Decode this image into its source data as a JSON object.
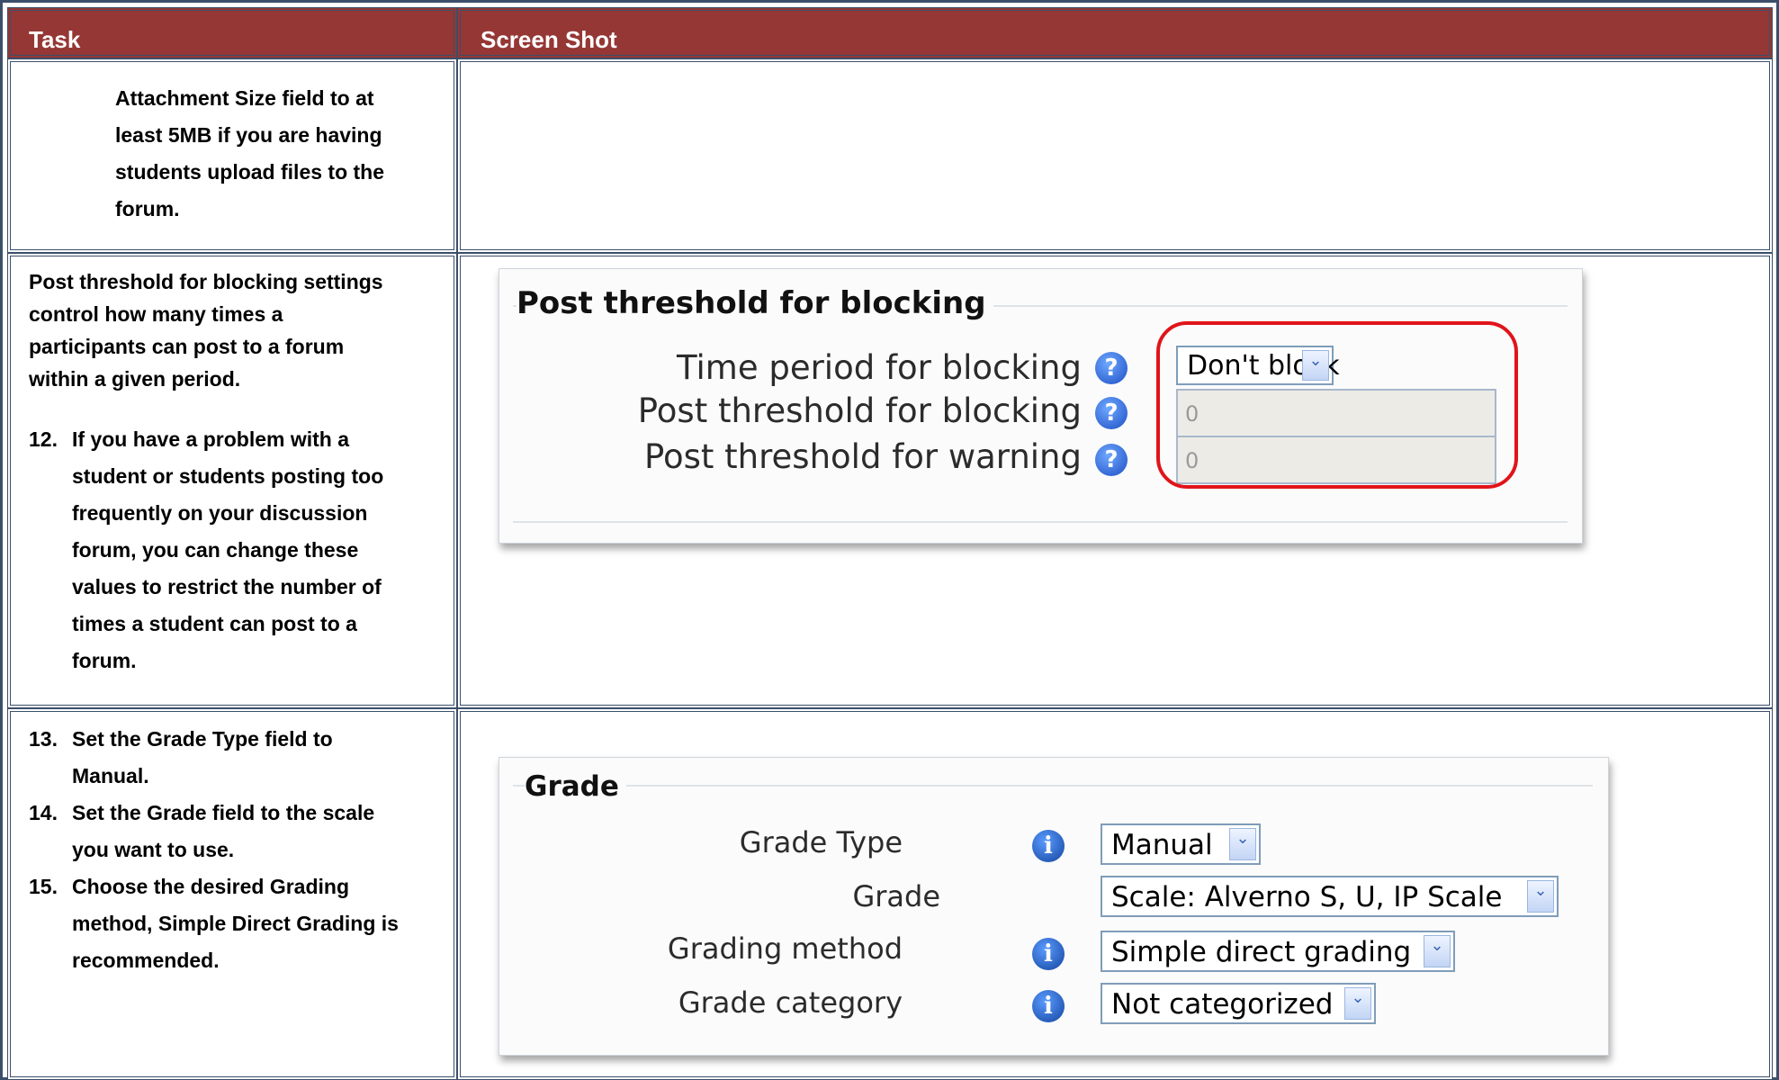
{
  "header": {
    "task": "Task",
    "screenshot": "Screen Shot"
  },
  "row1": {
    "lines": [
      "Attachment Size field to at",
      "least 5MB if you are having",
      "students upload files to the",
      "forum."
    ]
  },
  "row2": {
    "intro": [
      "Post threshold for blocking settings",
      "control how many times a",
      "participants can post to a forum",
      "within a given period."
    ],
    "step_num": "12.",
    "step_lines": [
      "If you have a problem with a",
      "student or students posting too",
      "frequently on your discussion",
      "forum, you can change these",
      "values to restrict the number of",
      "times a student can post to a",
      "forum."
    ],
    "panel": {
      "legend": "Post threshold for blocking",
      "time_label": "Time period for blocking",
      "time_value": "Don't block",
      "post_label": "Post threshold for blocking",
      "post_value": "0",
      "warn_label": "Post threshold for warning",
      "warn_value": "0",
      "help_glyph": "?",
      "help_icon": "help-question-icon",
      "highlight_color": "#e0141a"
    }
  },
  "row3": {
    "steps": [
      {
        "num": "13.",
        "lines": [
          "Set the Grade Type field to",
          "Manual."
        ]
      },
      {
        "num": "14.",
        "lines": [
          "Set the Grade field to the scale",
          "you want to use."
        ]
      },
      {
        "num": "15.",
        "lines": [
          "Choose the desired Grading",
          "method, Simple Direct Grading is",
          "recommended."
        ]
      }
    ],
    "panel": {
      "legend": "Grade",
      "grade_type_label": "Grade Type",
      "grade_type_value": "Manual",
      "grade_label": "Grade",
      "grade_value": "Scale: Alverno S, U, IP Scale",
      "method_label": "Grading method",
      "method_value": "Simple direct grading",
      "category_label": "Grade category",
      "category_value": "Not categorized",
      "info_glyph": "i",
      "info_icon": "info-icon",
      "dropdown_glyph": "⌄"
    }
  },
  "colors": {
    "header_bg": "#953735",
    "border": "#3b4f6a"
  }
}
